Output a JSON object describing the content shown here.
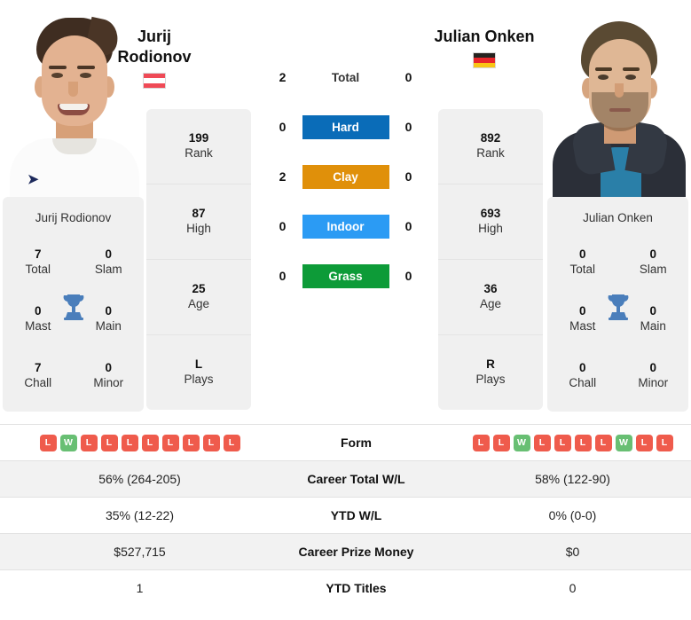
{
  "players": {
    "left": {
      "name_line1": "Jurij",
      "name_line2": "Rodionov",
      "full_name": "Jurij Rodionov",
      "country": "Austria",
      "flag_icon": "flag-austria",
      "photo_alt": "Jurij Rodionov headshot",
      "stats": [
        {
          "value": "199",
          "label": "Rank"
        },
        {
          "value": "87",
          "label": "High"
        },
        {
          "value": "25",
          "label": "Age"
        },
        {
          "value": "L",
          "label": "Plays"
        }
      ],
      "titles": {
        "total": "7",
        "total_label": "Total",
        "slam": "0",
        "slam_label": "Slam",
        "mast": "0",
        "mast_label": "Mast",
        "main": "0",
        "main_label": "Main",
        "chall": "7",
        "chall_label": "Chall",
        "minor": "0",
        "minor_label": "Minor"
      },
      "form": [
        "L",
        "W",
        "L",
        "L",
        "L",
        "L",
        "L",
        "L",
        "L",
        "L"
      ],
      "career_total_wl": "56% (264-205)",
      "ytd_wl": "35% (12-22)",
      "career_prize_money": "$527,715",
      "ytd_titles": "1"
    },
    "right": {
      "name_line1": "Julian Onken",
      "name_line2": "",
      "full_name": "Julian Onken",
      "country": "Germany",
      "flag_icon": "flag-germany",
      "photo_alt": "Julian Onken headshot",
      "stats": [
        {
          "value": "892",
          "label": "Rank"
        },
        {
          "value": "693",
          "label": "High"
        },
        {
          "value": "36",
          "label": "Age"
        },
        {
          "value": "R",
          "label": "Plays"
        }
      ],
      "titles": {
        "total": "0",
        "total_label": "Total",
        "slam": "0",
        "slam_label": "Slam",
        "mast": "0",
        "mast_label": "Mast",
        "main": "0",
        "main_label": "Main",
        "chall": "0",
        "chall_label": "Chall",
        "minor": "0",
        "minor_label": "Minor"
      },
      "form": [
        "L",
        "L",
        "W",
        "L",
        "L",
        "L",
        "L",
        "W",
        "L",
        "L"
      ],
      "career_total_wl": "58% (122-90)",
      "ytd_wl": "0% (0-0)",
      "career_prize_money": "$0",
      "ytd_titles": "0"
    }
  },
  "head_to_head": {
    "rows": [
      {
        "label": "Total",
        "left": "2",
        "right": "0",
        "color": "",
        "style": "plain"
      },
      {
        "label": "Hard",
        "left": "0",
        "right": "0",
        "color": "#0a6cb8",
        "style": "badge"
      },
      {
        "label": "Clay",
        "left": "2",
        "right": "0",
        "color": "#e0900a",
        "style": "badge"
      },
      {
        "label": "Indoor",
        "left": "0",
        "right": "0",
        "color": "#2b9bf4",
        "style": "badge"
      },
      {
        "label": "Grass",
        "left": "0",
        "right": "0",
        "color": "#0d9b38",
        "style": "badge"
      }
    ]
  },
  "comparison_table": {
    "rows": [
      {
        "label": "Form",
        "type": "form"
      },
      {
        "label": "Career Total W/L",
        "type": "text",
        "left_key": "career_total_wl",
        "right_key": "career_total_wl"
      },
      {
        "label": "YTD W/L",
        "type": "text",
        "left_key": "ytd_wl",
        "right_key": "ytd_wl"
      },
      {
        "label": "Career Prize Money",
        "type": "text",
        "left_key": "career_prize_money",
        "right_key": "career_prize_money"
      },
      {
        "label": "YTD Titles",
        "type": "text",
        "left_key": "ytd_titles",
        "right_key": "ytd_titles"
      }
    ]
  },
  "colors": {
    "hard": "#0a6cb8",
    "clay": "#e0900a",
    "indoor": "#2b9bf4",
    "grass": "#0d9b38",
    "win": "#68bf73",
    "loss": "#ef5b4c",
    "card_bg": "#f0f0f0",
    "row_alt": "#f2f2f2"
  },
  "icons": {
    "trophy": "trophy-icon"
  }
}
